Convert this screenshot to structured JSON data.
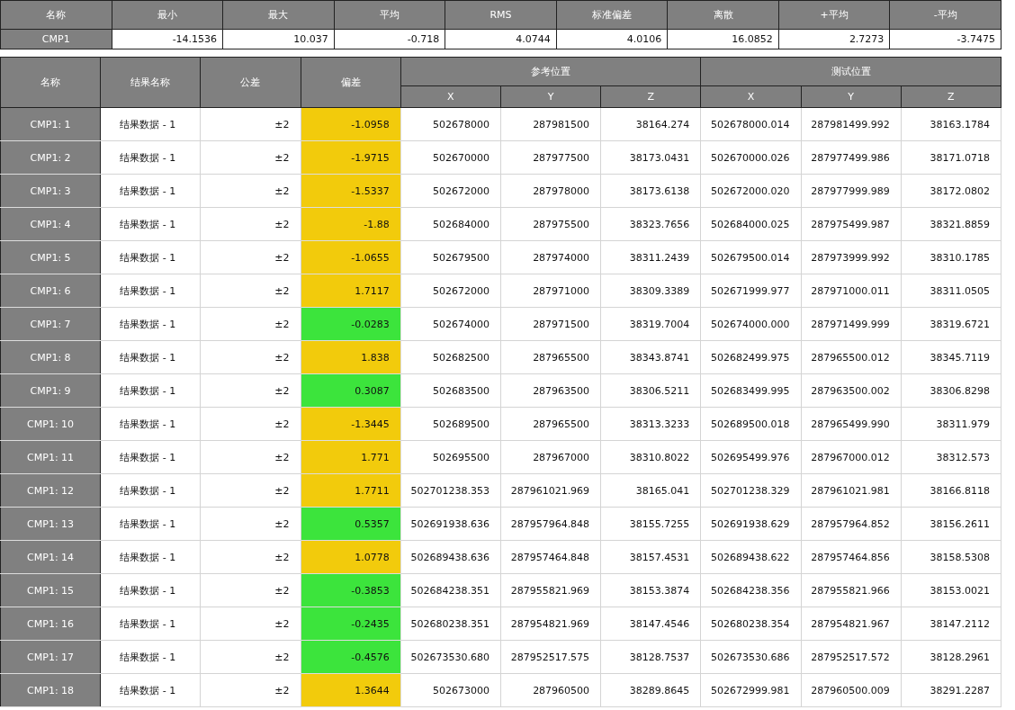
{
  "summary": {
    "columns": [
      "名称",
      "最小",
      "最大",
      "平均",
      "RMS",
      "标准偏差",
      "离散",
      "+平均",
      "-平均"
    ],
    "rows": [
      [
        "CMP1",
        "-14.1536",
        "10.037",
        "-0.718",
        "4.0744",
        "4.0106",
        "16.0852",
        "2.7273",
        "-3.7475"
      ]
    ]
  },
  "results": {
    "columns": [
      "名称",
      "结果名称",
      "公差",
      "偏差"
    ],
    "groups": [
      {
        "label": "参考位置",
        "axes": [
          "X",
          "Y",
          "Z"
        ]
      },
      {
        "label": "测试位置",
        "axes": [
          "X",
          "Y",
          "Z"
        ]
      }
    ],
    "rows": [
      {
        "name": "CMP1: 1",
        "result": "结果数据 - 1",
        "tolerance": "±2",
        "deviation": {
          "value": "-1.0958",
          "color": "#f2cb0c"
        },
        "reference": [
          "502678000",
          "287981500",
          "38164.274"
        ],
        "measured": [
          "502678000.014",
          "287981499.992",
          "38163.1784"
        ]
      },
      {
        "name": "CMP1: 2",
        "result": "结果数据 - 1",
        "tolerance": "±2",
        "deviation": {
          "value": "-1.9715",
          "color": "#f2cb0c"
        },
        "reference": [
          "502670000",
          "287977500",
          "38173.0431"
        ],
        "measured": [
          "502670000.026",
          "287977499.986",
          "38171.0718"
        ]
      },
      {
        "name": "CMP1: 3",
        "result": "结果数据 - 1",
        "tolerance": "±2",
        "deviation": {
          "value": "-1.5337",
          "color": "#f2cb0c"
        },
        "reference": [
          "502672000",
          "287978000",
          "38173.6138"
        ],
        "measured": [
          "502672000.020",
          "287977999.989",
          "38172.0802"
        ]
      },
      {
        "name": "CMP1: 4",
        "result": "结果数据 - 1",
        "tolerance": "±2",
        "deviation": {
          "value": "-1.88",
          "color": "#f2cb0c"
        },
        "reference": [
          "502684000",
          "287975500",
          "38323.7656"
        ],
        "measured": [
          "502684000.025",
          "287975499.987",
          "38321.8859"
        ]
      },
      {
        "name": "CMP1: 5",
        "result": "结果数据 - 1",
        "tolerance": "±2",
        "deviation": {
          "value": "-1.0655",
          "color": "#f2cb0c"
        },
        "reference": [
          "502679500",
          "287974000",
          "38311.2439"
        ],
        "measured": [
          "502679500.014",
          "287973999.992",
          "38310.1785"
        ]
      },
      {
        "name": "CMP1: 6",
        "result": "结果数据 - 1",
        "tolerance": "±2",
        "deviation": {
          "value": "1.7117",
          "color": "#f2cb0c"
        },
        "reference": [
          "502672000",
          "287971000",
          "38309.3389"
        ],
        "measured": [
          "502671999.977",
          "287971000.011",
          "38311.0505"
        ]
      },
      {
        "name": "CMP1: 7",
        "result": "结果数据 - 1",
        "tolerance": "±2",
        "deviation": {
          "value": "-0.0283",
          "color": "#3ce43c"
        },
        "reference": [
          "502674000",
          "287971500",
          "38319.7004"
        ],
        "measured": [
          "502674000.000",
          "287971499.999",
          "38319.6721"
        ]
      },
      {
        "name": "CMP1: 8",
        "result": "结果数据 - 1",
        "tolerance": "±2",
        "deviation": {
          "value": "1.838",
          "color": "#f2cb0c"
        },
        "reference": [
          "502682500",
          "287965500",
          "38343.8741"
        ],
        "measured": [
          "502682499.975",
          "287965500.012",
          "38345.7119"
        ]
      },
      {
        "name": "CMP1: 9",
        "result": "结果数据 - 1",
        "tolerance": "±2",
        "deviation": {
          "value": "0.3087",
          "color": "#3ce43c"
        },
        "reference": [
          "502683500",
          "287963500",
          "38306.5211"
        ],
        "measured": [
          "502683499.995",
          "287963500.002",
          "38306.8298"
        ]
      },
      {
        "name": "CMP1: 10",
        "result": "结果数据 - 1",
        "tolerance": "±2",
        "deviation": {
          "value": "-1.3445",
          "color": "#f2cb0c"
        },
        "reference": [
          "502689500",
          "287965500",
          "38313.3233"
        ],
        "measured": [
          "502689500.018",
          "287965499.990",
          "38311.979"
        ]
      },
      {
        "name": "CMP1: 11",
        "result": "结果数据 - 1",
        "tolerance": "±2",
        "deviation": {
          "value": "1.771",
          "color": "#f2cb0c"
        },
        "reference": [
          "502695500",
          "287967000",
          "38310.8022"
        ],
        "measured": [
          "502695499.976",
          "287967000.012",
          "38312.573"
        ]
      },
      {
        "name": "CMP1: 12",
        "result": "结果数据 - 1",
        "tolerance": "±2",
        "deviation": {
          "value": "1.7711",
          "color": "#f2cb0c"
        },
        "reference": [
          "502701238.353",
          "287961021.969",
          "38165.041"
        ],
        "measured": [
          "502701238.329",
          "287961021.981",
          "38166.8118"
        ]
      },
      {
        "name": "CMP1: 13",
        "result": "结果数据 - 1",
        "tolerance": "±2",
        "deviation": {
          "value": "0.5357",
          "color": "#3ce43c"
        },
        "reference": [
          "502691938.636",
          "287957964.848",
          "38155.7255"
        ],
        "measured": [
          "502691938.629",
          "287957964.852",
          "38156.2611"
        ]
      },
      {
        "name": "CMP1: 14",
        "result": "结果数据 - 1",
        "tolerance": "±2",
        "deviation": {
          "value": "1.0778",
          "color": "#f2cb0c"
        },
        "reference": [
          "502689438.636",
          "287957464.848",
          "38157.4531"
        ],
        "measured": [
          "502689438.622",
          "287957464.856",
          "38158.5308"
        ]
      },
      {
        "name": "CMP1: 15",
        "result": "结果数据 - 1",
        "tolerance": "±2",
        "deviation": {
          "value": "-0.3853",
          "color": "#3ce43c"
        },
        "reference": [
          "502684238.351",
          "287955821.969",
          "38153.3874"
        ],
        "measured": [
          "502684238.356",
          "287955821.966",
          "38153.0021"
        ]
      },
      {
        "name": "CMP1: 16",
        "result": "结果数据 - 1",
        "tolerance": "±2",
        "deviation": {
          "value": "-0.2435",
          "color": "#3ce43c"
        },
        "reference": [
          "502680238.351",
          "287954821.969",
          "38147.4546"
        ],
        "measured": [
          "502680238.354",
          "287954821.967",
          "38147.2112"
        ]
      },
      {
        "name": "CMP1: 17",
        "result": "结果数据 - 1",
        "tolerance": "±2",
        "deviation": {
          "value": "-0.4576",
          "color": "#3ce43c"
        },
        "reference": [
          "502673530.680",
          "287952517.575",
          "38128.7537"
        ],
        "measured": [
          "502673530.686",
          "287952517.572",
          "38128.2961"
        ]
      },
      {
        "name": "CMP1: 18",
        "result": "结果数据 - 1",
        "tolerance": "±2",
        "deviation": {
          "value": "1.3644",
          "color": "#f2cb0c"
        },
        "reference": [
          "502673000",
          "287960500",
          "38289.8645"
        ],
        "measured": [
          "502672999.981",
          "287960500.009",
          "38291.2287"
        ]
      }
    ]
  }
}
